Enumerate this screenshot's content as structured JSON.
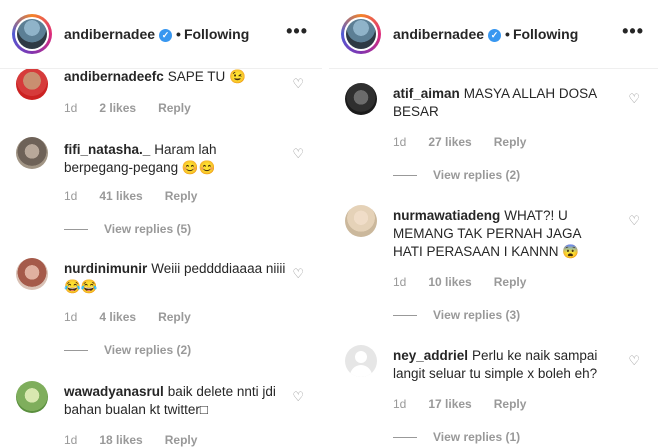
{
  "left": {
    "header": {
      "username": "andibernadee",
      "dot": "•",
      "following": "Following",
      "more": "•••"
    },
    "comments": [
      {
        "user": "andibernadeefc",
        "text": "SAPE TU 😉",
        "time": "1d",
        "likes": "2 likes",
        "reply": "Reply",
        "view": ""
      },
      {
        "user": "fifi_natasha._",
        "text": "Haram lah berpegang-pegang 😊😊",
        "time": "1d",
        "likes": "41 likes",
        "reply": "Reply",
        "view": "View replies (5)"
      },
      {
        "user": "nurdinimunir",
        "text": "Weiii peddddiaaaa niiii😂😂",
        "time": "1d",
        "likes": "4 likes",
        "reply": "Reply",
        "view": "View replies (2)"
      },
      {
        "user": "wawadyanasrul",
        "text": "baik delete nnti jdi bahan bualan kt twitter□",
        "time": "1d",
        "likes": "18 likes",
        "reply": "Reply",
        "view": ""
      }
    ]
  },
  "right": {
    "header": {
      "username": "andibernadee",
      "dot": "•",
      "following": "Following",
      "more": "•••"
    },
    "comments": [
      {
        "user": "atif_aiman",
        "text": "MASYA ALLAH DOSA BESAR",
        "time": "1d",
        "likes": "27 likes",
        "reply": "Reply",
        "view": "View replies (2)"
      },
      {
        "user": "nurmawatiadeng",
        "text": "WHAT?! U MEMANG TAK PERNAH JAGA HATI PERASAAN I KANNN 😨",
        "time": "1d",
        "likes": "10 likes",
        "reply": "Reply",
        "view": "View replies (3)"
      },
      {
        "user": "ney_addriel",
        "text": "Perlu ke naik sampai langit seluar tu simple x boleh eh?",
        "time": "1d",
        "likes": "17 likes",
        "reply": "Reply",
        "view": "View replies (1)"
      }
    ]
  },
  "icons": {
    "heart": "heart-outline-icon",
    "verified": "verified-badge-icon",
    "more": "more-options-icon"
  }
}
